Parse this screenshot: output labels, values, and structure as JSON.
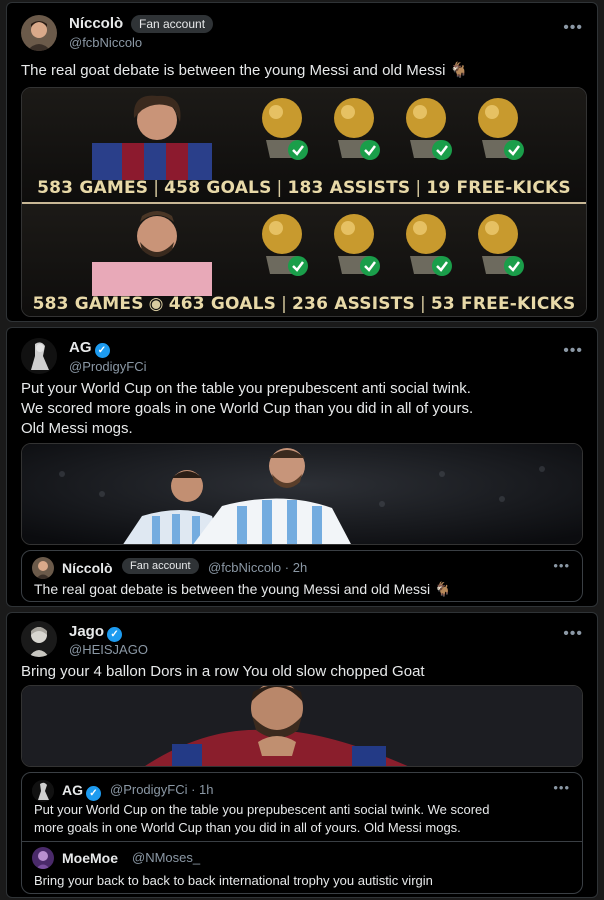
{
  "post1": {
    "name": "Níccolò",
    "badge": "Fan account",
    "handle": "@fcbNiccolo",
    "text": "The real goat debate is between the young Messi and old Messi 🐐",
    "menu": "•••",
    "comparison": {
      "row1": {
        "games": "583 GAMES",
        "goals": "458 GOALS",
        "assists": "183 ASSISTS",
        "freekicks": "19 FREE-KICKS",
        "trophies": 4
      },
      "row2": {
        "games": "583 GAMES",
        "goals": "463 GOALS",
        "assists": "236 ASSISTS",
        "freekicks": "53 FREE-KICKS",
        "trophies": 4
      },
      "separator": "|"
    }
  },
  "post2": {
    "name": "AG",
    "handle": "@ProdigyFCi",
    "text_lines": [
      "Put your World Cup on the table you prepubescent anti social twink.",
      "We scored more goals in one World Cup than you did in all of yours.",
      "Old Messi mogs."
    ],
    "menu": "•••",
    "quoted": {
      "name": "Níccolò",
      "badge": "Fan account",
      "handle": "@fcbNiccolo · 2h",
      "text": "The real goat debate is between the young Messi and old Messi 🐐",
      "menu": "•••"
    }
  },
  "post3": {
    "name": "Jago",
    "handle": "@HEISJAGO",
    "text": "Bring your 4 ballon Dors in a row You old slow chopped Goat",
    "menu": "•••",
    "quoted": {
      "name": "AG",
      "handle": "@ProdigyFCi · 1h",
      "text_lines": [
        "Put your World Cup on the table you prepubescent anti social twink. We scored",
        "more goals in one World Cup than you did in all of yours. Old Messi mogs."
      ],
      "menu": "•••",
      "reply": {
        "name": "MoeMoe",
        "handle": "@NMoses_",
        "text": "Bring your back to back to back international trophy you autistic virgin"
      }
    }
  },
  "colors": {
    "background": "#000000",
    "border": "#2f3336",
    "verified": "#1d9bf0",
    "check": "#1a9e4a",
    "gold": "#e8d9a8"
  }
}
